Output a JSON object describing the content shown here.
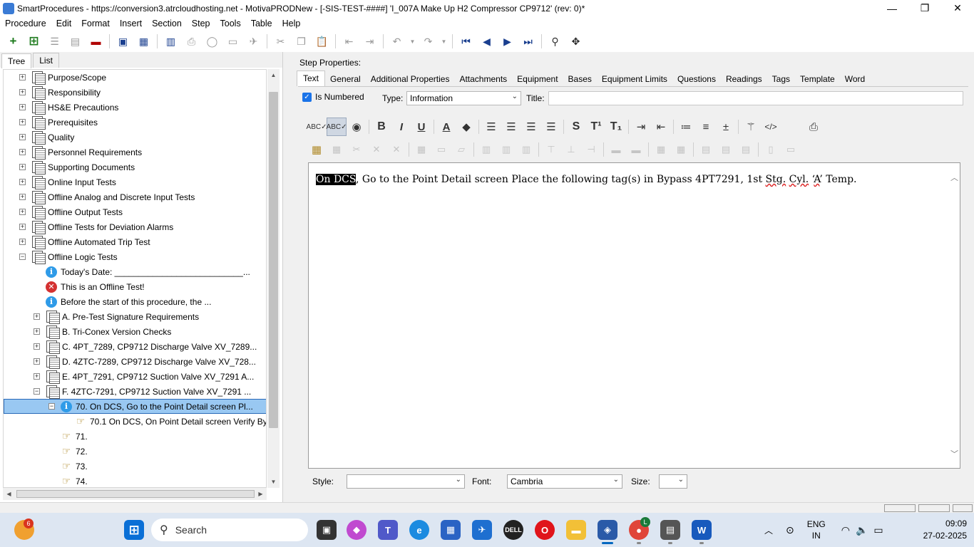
{
  "window": {
    "title": "SmartProcedures - https://conversion3.atrcloudhosting.net - MotivaPRODNew - [-SIS-TEST-####] 'I_007A Make Up H2 Compressor CP9712' (rev: 0)*",
    "minimize": "—",
    "maximize": "❐",
    "close": "✕"
  },
  "menu": [
    "Procedure",
    "Edit",
    "Format",
    "Insert",
    "Section",
    "Step",
    "Tools",
    "Table",
    "Help"
  ],
  "left_panel": {
    "tabs": [
      "Tree",
      "List"
    ],
    "tree": [
      {
        "label": "Purpose/Scope",
        "icon": "doc",
        "expander": "+",
        "level": 1
      },
      {
        "label": "Responsibility",
        "icon": "doc",
        "expander": "+",
        "level": 1
      },
      {
        "label": "HS&E Precautions",
        "icon": "doc",
        "expander": "+",
        "level": 1
      },
      {
        "label": "Prerequisites",
        "icon": "doc",
        "expander": "+",
        "level": 1
      },
      {
        "label": "Quality",
        "icon": "doc",
        "expander": "+",
        "level": 1
      },
      {
        "label": "Personnel Requirements",
        "icon": "doc",
        "expander": "+",
        "level": 1
      },
      {
        "label": "Supporting Documents",
        "icon": "doc",
        "expander": "+",
        "level": 1
      },
      {
        "label": "Online Input Tests",
        "icon": "doc",
        "expander": "+",
        "level": 1
      },
      {
        "label": "Offline Analog and Discrete Input Tests",
        "icon": "doc",
        "expander": "+",
        "level": 1
      },
      {
        "label": "Offline Output Tests",
        "icon": "doc",
        "expander": "+",
        "level": 1
      },
      {
        "label": "Offline Tests for Deviation Alarms",
        "icon": "doc",
        "expander": "+",
        "level": 1
      },
      {
        "label": "Offline Automated Trip Test",
        "icon": "doc",
        "expander": "+",
        "level": 1
      },
      {
        "label": "Offline Logic Tests",
        "icon": "doc",
        "expander": "−",
        "level": 1
      },
      {
        "label": "Today's Date: ___________________________...",
        "icon": "info",
        "expander": "",
        "level": 2
      },
      {
        "label": "This is an Offline Test!",
        "icon": "error",
        "expander": "",
        "level": 2
      },
      {
        "label": "Before the start of this procedure, the ...",
        "icon": "info",
        "expander": "",
        "level": 2
      },
      {
        "label": "A. Pre-Test Signature Requirements",
        "icon": "doc",
        "expander": "+",
        "level": 2
      },
      {
        "label": "B. Tri-Conex Version Checks",
        "icon": "doc",
        "expander": "+",
        "level": 2
      },
      {
        "label": "C. 4PT_7289, CP9712 Discharge Valve XV_7289...",
        "icon": "doc",
        "expander": "+",
        "level": 2
      },
      {
        "label": "D. 4ZTC-7289, CP9712 Discharge Valve XV_728...",
        "icon": "doc",
        "expander": "+",
        "level": 2
      },
      {
        "label": "E. 4PT_7291, CP9712 Suction Valve XV_7291 A...",
        "icon": "doc",
        "expander": "+",
        "level": 2
      },
      {
        "label": "F. 4ZTC-7291, CP9712 Suction Valve XV_7291 ...",
        "icon": "doc",
        "expander": "−",
        "level": 2
      },
      {
        "label": "70. On DCS, Go to the Point Detail screen Pl...",
        "icon": "info",
        "expander": "−",
        "level": 3,
        "selected": true
      },
      {
        "label": "70.1 On DCS, On Point Detail screen Verify By...",
        "icon": "hand",
        "expander": "",
        "level": 4
      },
      {
        "label": "71.",
        "icon": "hand",
        "expander": "",
        "level": 3
      },
      {
        "label": "72.",
        "icon": "hand",
        "expander": "",
        "level": 3
      },
      {
        "label": "73.",
        "icon": "hand",
        "expander": "",
        "level": 3
      },
      {
        "label": "74.",
        "icon": "hand",
        "expander": "",
        "level": 3
      }
    ]
  },
  "step_properties": {
    "label": "Step Properties:",
    "tabs": [
      "Text",
      "General",
      "Additional Properties",
      "Attachments",
      "Equipment",
      "Bases",
      "Equipment Limits",
      "Questions",
      "Readings",
      "Tags",
      "Template",
      "Word"
    ],
    "is_numbered_label": "Is Numbered",
    "type_label": "Type:",
    "type_value": "Information",
    "title_label": "Title:",
    "title_value": "",
    "editor": {
      "highlight": "On DCS",
      "part1": ", Go to the Point Detail screen Place the following tag(s) in Bypass 4PT7291, 1st ",
      "sq1": "Stg.",
      "sp1": " ",
      "sq2": "Cyl.",
      "sp2": " ‘",
      "sq3": "A",
      "part2": "’ Temp."
    },
    "style_label": "Style:",
    "style_value": "",
    "font_label": "Font:",
    "font_value": "Cambria",
    "size_label": "Size:",
    "size_value": ""
  },
  "taskbar": {
    "search_placeholder": "Search",
    "weather_badge": "6",
    "chrome_badge": "L",
    "lang_line1": "ENG",
    "lang_line2": "IN",
    "time": "09:09",
    "date": "27-02-2025"
  },
  "colors": {
    "selection": "#99c8f2",
    "accent": "#0067c0",
    "taskbar": "#dde6f2"
  }
}
